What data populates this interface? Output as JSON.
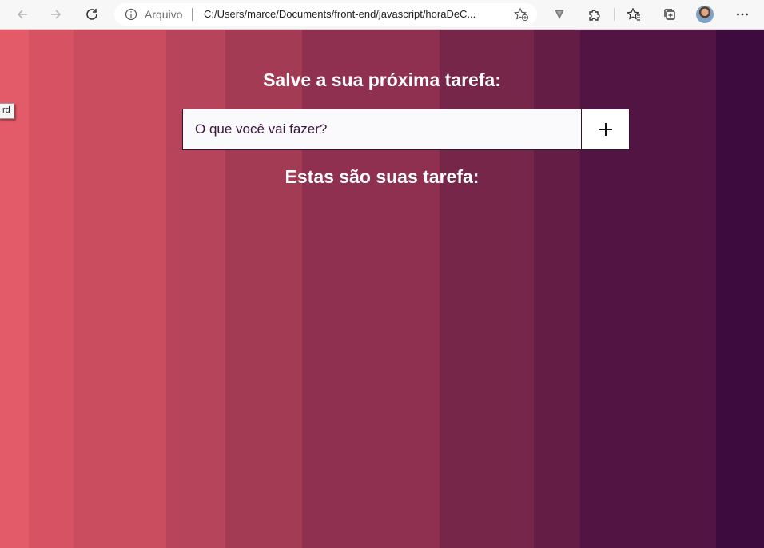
{
  "browser": {
    "address_scheme": "Arquivo",
    "url": "C:/Users/marce/Documents/front-end/javascript/horaDeC...",
    "icons": [
      "back-arrow-icon",
      "forward-arrow-icon",
      "refresh-icon",
      "info-icon",
      "add-favorite-icon",
      "extension-v-icon",
      "puzzle-extensions-icon",
      "favorites-icon",
      "collections-icon",
      "profile-avatar",
      "more-icon"
    ]
  },
  "page": {
    "heading_save": "Salve a sua próxima tarefa:",
    "input_placeholder": "O que você vai fazer?",
    "add_button_label": "+",
    "heading_tasks": "Estas são suas tarefa:",
    "tooltip_fragment": "rd"
  },
  "colors": {
    "gradient_start": "#e35a68",
    "gradient_end": "#3d0b3d",
    "heading": "#ffffff"
  }
}
